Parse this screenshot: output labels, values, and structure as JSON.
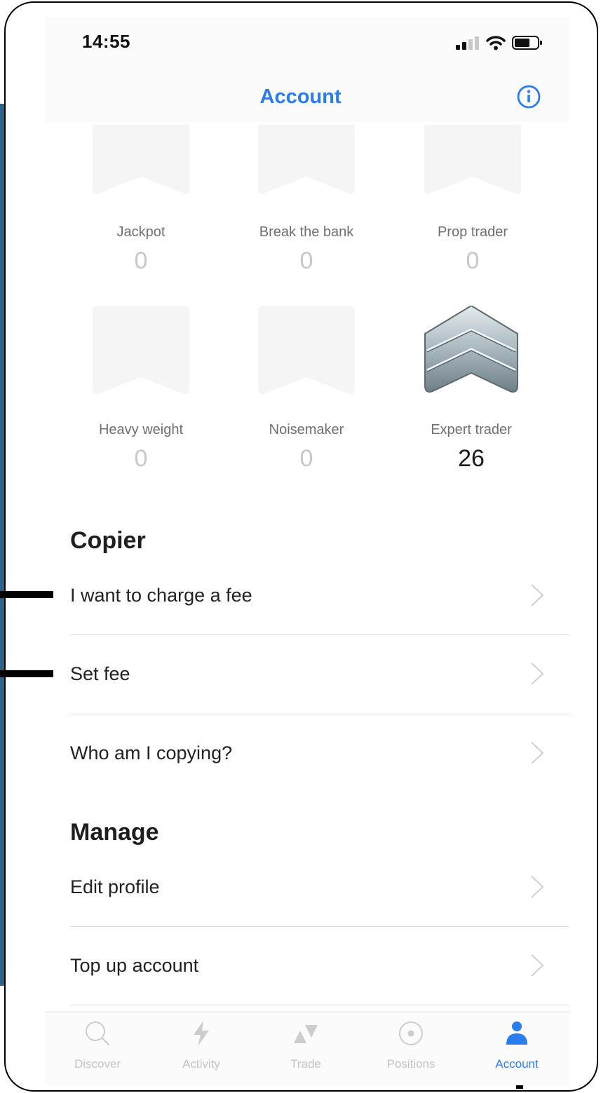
{
  "status_bar": {
    "time": "14:55"
  },
  "header": {
    "title": "Account"
  },
  "badges": [
    {
      "name": "Jackpot",
      "value": "0"
    },
    {
      "name": "Break the bank",
      "value": "0"
    },
    {
      "name": "Prop trader",
      "value": "0"
    },
    {
      "name": "Heavy weight",
      "value": "0"
    },
    {
      "name": "Noisemaker",
      "value": "0"
    },
    {
      "name": "Expert trader",
      "value": "26"
    }
  ],
  "copier": {
    "title": "Copier",
    "items": [
      "I want to charge a fee",
      "Set fee",
      "Who am I copying?"
    ]
  },
  "manage": {
    "title": "Manage",
    "items": [
      "Edit profile",
      "Top up account"
    ]
  },
  "tabbar": {
    "tabs": [
      {
        "label": "Discover",
        "icon": "search-icon"
      },
      {
        "label": "Activity",
        "icon": "lightning-icon"
      },
      {
        "label": "Trade",
        "icon": "up-down-triangles-icon"
      },
      {
        "label": "Positions",
        "icon": "target-icon"
      },
      {
        "label": "Account",
        "icon": "person-icon"
      }
    ],
    "active": "Account"
  },
  "colors": {
    "accent": "#2b7cf0",
    "side_bar": "#2d6185"
  }
}
